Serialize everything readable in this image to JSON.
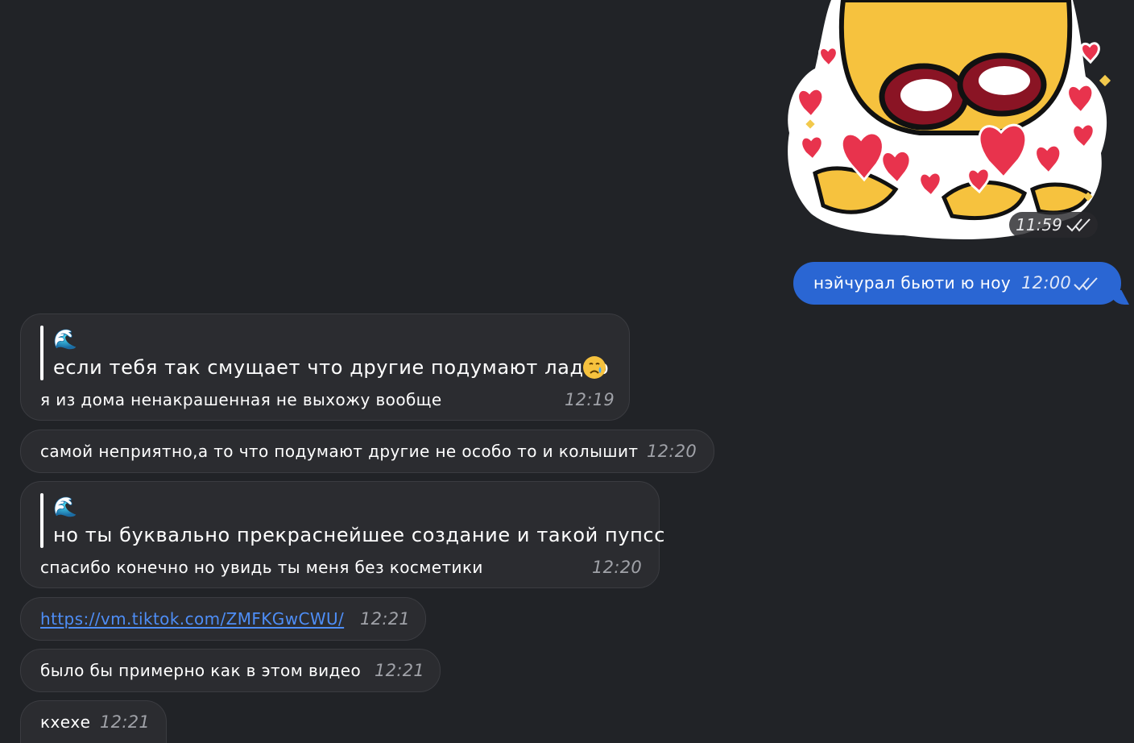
{
  "sticker": {
    "icon": "crying-duck-hearts-sticker",
    "time": "11:59",
    "status": "read"
  },
  "messages": [
    {
      "direction": "outgoing",
      "text": "нэйчурал бьюти ю ноу",
      "time": "12:00",
      "status": "read"
    },
    {
      "direction": "incoming",
      "reply_emoji": "🌊",
      "reply_text": "если тебя так смущает что другие подумают ладно",
      "text": "я из дома ненакрашенная не выхожу вообще",
      "time": "12:19"
    },
    {
      "direction": "incoming",
      "text": "самой неприятно,а то что подумают другие не особо то и колышит",
      "time": "12:20"
    },
    {
      "direction": "incoming",
      "reply_emoji": "🌊",
      "reply_text": "но ты буквально прекраснейшее создание и такой пупсс",
      "text": "спасибо конечно но увидь ты меня без косметики",
      "time": "12:20"
    },
    {
      "direction": "incoming",
      "link": "https://vm.tiktok.com/ZMFKGwCWU/",
      "time": "12:21"
    },
    {
      "direction": "incoming",
      "text": "было бы примерно как в этом видео",
      "time": "12:21"
    },
    {
      "direction": "incoming",
      "text": "кхехе",
      "time": "12:21"
    }
  ],
  "colors": {
    "background": "#212327",
    "incoming_bubble": "#2b2c30",
    "outgoing_bubble": "#2a66d3",
    "link": "#4e8ef7"
  }
}
